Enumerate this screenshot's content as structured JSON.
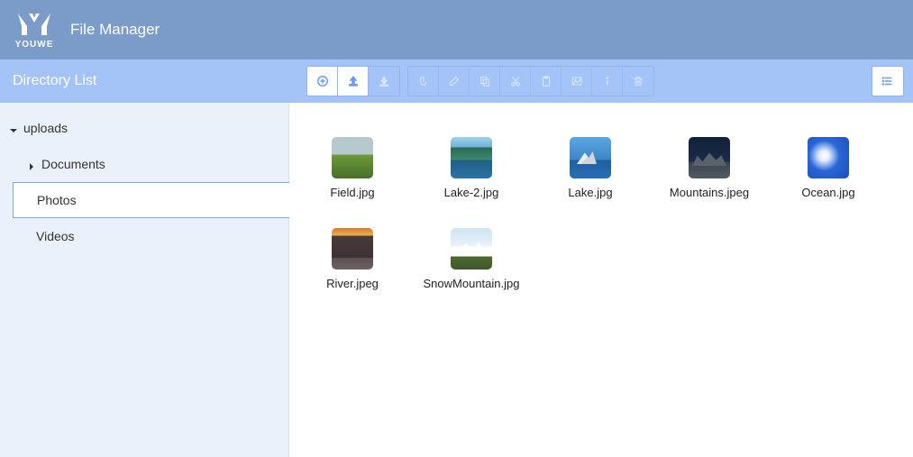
{
  "brand": {
    "name": "YOUWE"
  },
  "app": {
    "title": "File Manager"
  },
  "sidebar": {
    "title": "Directory List",
    "tree": {
      "root": {
        "label": "uploads",
        "expanded": true
      },
      "children": [
        {
          "label": "Documents",
          "expanded": false,
          "hasChildren": true,
          "selected": false
        },
        {
          "label": "Photos",
          "expanded": false,
          "hasChildren": false,
          "selected": true
        },
        {
          "label": "Videos",
          "expanded": false,
          "hasChildren": false,
          "selected": false
        }
      ]
    }
  },
  "toolbar": {
    "groups": [
      {
        "buttons": [
          "add",
          "upload",
          "download"
        ]
      },
      {
        "buttons": [
          "select",
          "edit",
          "copy",
          "cut",
          "paste",
          "image",
          "info",
          "delete"
        ]
      }
    ],
    "view": "list"
  },
  "files": [
    {
      "name": "Field.jpg",
      "thumbClass": "th-field"
    },
    {
      "name": "Lake-2.jpg",
      "thumbClass": "th-lake2"
    },
    {
      "name": "Lake.jpg",
      "thumbClass": "th-lake"
    },
    {
      "name": "Mountains.jpeg",
      "thumbClass": "th-mountains"
    },
    {
      "name": "Ocean.jpg",
      "thumbClass": "th-ocean"
    },
    {
      "name": "River.jpeg",
      "thumbClass": "th-river"
    },
    {
      "name": "SnowMountain.jpg",
      "thumbClass": "th-snow"
    }
  ]
}
